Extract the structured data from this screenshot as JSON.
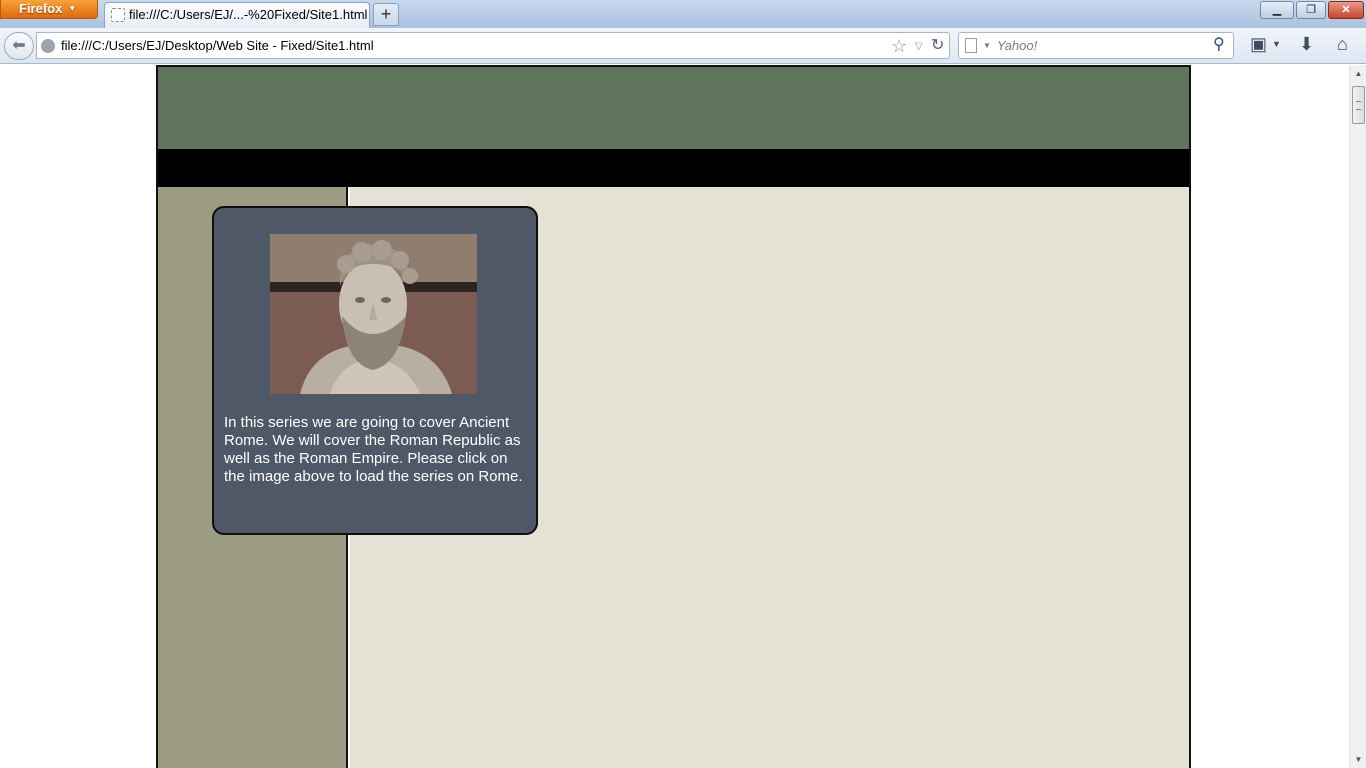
{
  "browser": {
    "menu_label": "Firefox",
    "tab_title": "file:///C:/Users/EJ/...-%20Fixed/Site1.html",
    "new_tab_label": "+",
    "url": "file:///C:/Users/EJ/Desktop/Web Site - Fixed/Site1.html",
    "search_placeholder": "Yahoo!",
    "icons": {
      "back": "back-arrow-icon",
      "page": "globe-icon",
      "bookmark": "star-icon",
      "reload": "reload-icon",
      "search": "magnifier-icon",
      "bookmarks_menu": "bookmarks-icon",
      "downloads": "download-arrow-icon",
      "home": "home-icon"
    }
  },
  "page": {
    "colors": {
      "header": "#5f735d",
      "nav_strip": "#000000",
      "sidebar": "#9c9c82",
      "content": "#e5e2d5",
      "card": "#4f5866"
    },
    "card": {
      "image_subject": "marble bust of a bearded Roman emperor",
      "text": "In this series we are going to cover Ancient Rome. We will cover the Roman Republic as well as the Roman Empire. Please click on the image above to load the series on Rome."
    }
  }
}
